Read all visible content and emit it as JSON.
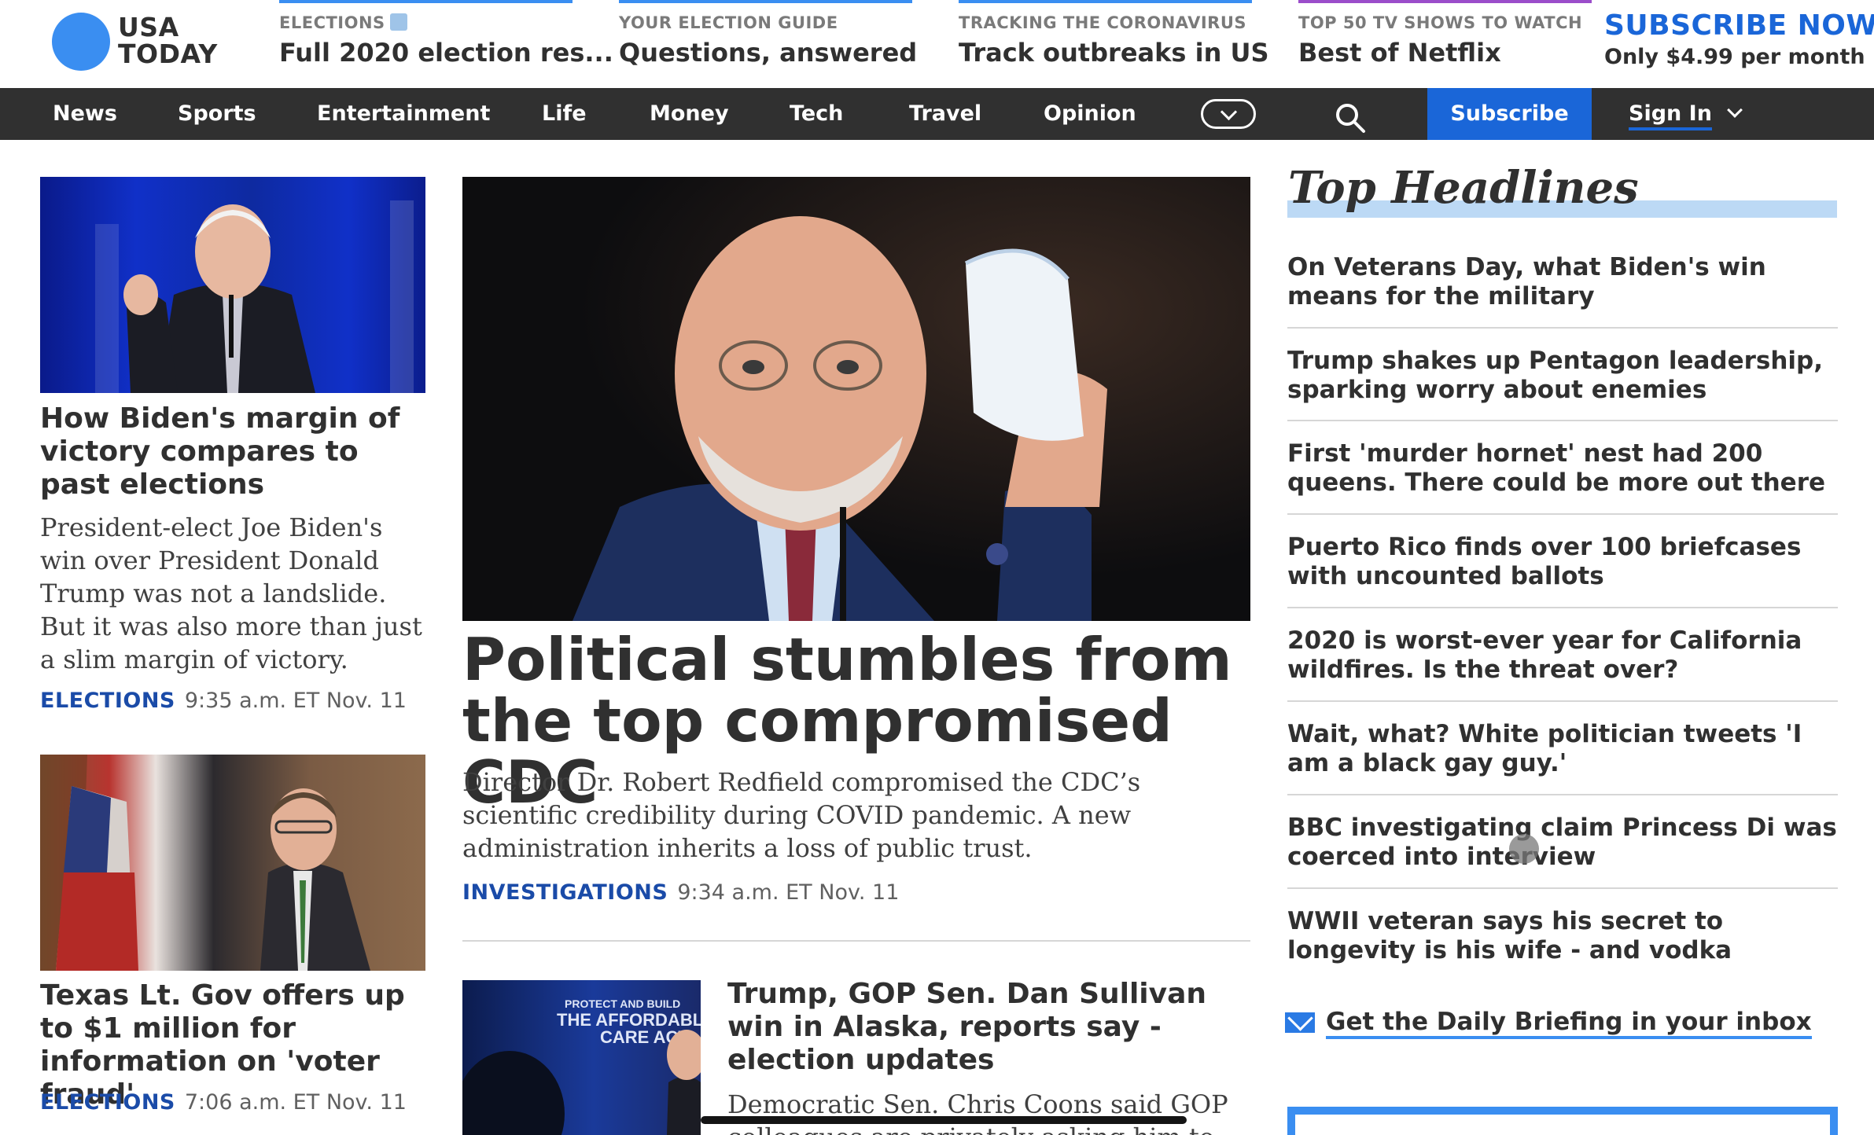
{
  "brand": {
    "logo_line1": "USA",
    "logo_line2": "TODAY",
    "accent": "#3a8ef1",
    "nav_bg": "#303030",
    "subscribe_blue": "#1a66d8"
  },
  "promos": [
    {
      "kicker": "ELECTIONS",
      "headline": "Full 2020 election res...",
      "bar_color": "#3a8ef1",
      "icon": "ballot-box-icon"
    },
    {
      "kicker": "YOUR ELECTION GUIDE",
      "headline": "Questions, answered",
      "bar_color": "#3a8ef1"
    },
    {
      "kicker": "TRACKING THE CORONAVIRUS",
      "headline": "Track outbreaks in US",
      "bar_color": "#3a8ef1"
    },
    {
      "kicker": "TOP 50 TV SHOWS TO WATCH",
      "headline": "Best of Netflix",
      "bar_color": "#9b4dca"
    }
  ],
  "subscribe_promo": {
    "title": "SUBSCRIBE NOW",
    "price": "Only $4.99 per month"
  },
  "nav": {
    "items": [
      "News",
      "Sports",
      "Entertainment",
      "Life",
      "Money",
      "Tech",
      "Travel",
      "Opinion"
    ],
    "subscribe_label": "Subscribe",
    "signin_label": "Sign In"
  },
  "left_stories": [
    {
      "headline": "How Biden's margin of victory compares to past elections",
      "summary": "President-elect Joe Biden's win over President Donald Trump was not a landslide. But it was also more than just a slim margin of victory.",
      "section": "ELECTIONS",
      "time": "9:35 a.m. ET Nov. 11"
    },
    {
      "headline": "Texas Lt. Gov offers up to $1 million for information on 'voter fraud'",
      "section": "ELECTIONS",
      "time": "7:06 a.m. ET Nov. 11"
    }
  ],
  "lead_story": {
    "headline": "Political stumbles from the top compromised CDC",
    "summary": "Director Dr. Robert Redfield compromised the CDC’s scientific credibility during COVID pandemic. A new administration inherits a loss of public trust.",
    "section": "INVESTIGATIONS",
    "time": "9:34 a.m. ET Nov. 11"
  },
  "secondary_story": {
    "headline": "Trump, GOP Sen. Dan Sullivan win in Alaska, reports say - election updates",
    "summary": "Democratic Sen. Chris Coons said GOP colleagues are privately asking him to",
    "image_sign": "PROTECT AND BUILD THE AFFORDABLE CARE ACT"
  },
  "top_headlines": {
    "title": "Top Headlines",
    "items": [
      "On Veterans Day, what Biden's win means for the military",
      "Trump shakes up Pentagon leadership, sparking worry about enemies",
      "First 'murder hornet' nest had 200 queens. There could be more out there",
      "Puerto Rico finds over 100 briefcases with uncounted ballots",
      "2020 is worst-ever year for California wildfires. Is the threat over?",
      "Wait, what? White politician tweets 'I am a black gay guy.'",
      "BBC investigating claim Princess Di was coerced into interview",
      "WWII veteran says his secret to longevity is his wife - and vodka"
    ]
  },
  "newsletter": {
    "label": "Get the Daily Briefing in your inbox"
  }
}
